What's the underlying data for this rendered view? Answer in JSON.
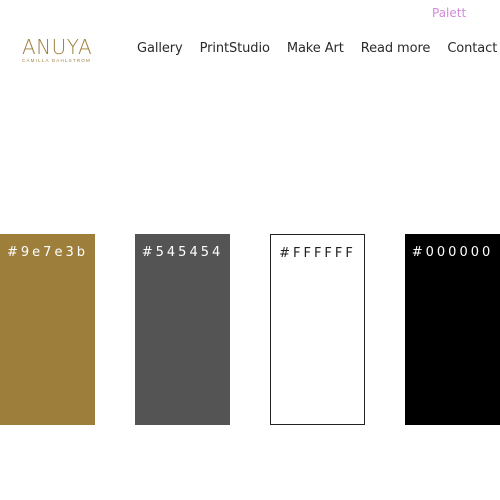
{
  "top_link": {
    "label": "Palett",
    "color": "#d48ad8"
  },
  "logo": {
    "name": "ANUYA",
    "tagline": "CAMILLA DAHLSTROM",
    "color": "#9e7e3b"
  },
  "nav": {
    "items": [
      "Gallery",
      "PrintStudio",
      "Make Art",
      "Read more",
      "Contact"
    ]
  },
  "swatches": [
    {
      "label": "#9e7e3b",
      "color": "#9e7e3b",
      "text_color": "#ffffff",
      "border": "none"
    },
    {
      "label": "#545454",
      "color": "#545454",
      "text_color": "#ffffff",
      "border": "none"
    },
    {
      "label": "#FFFFFF",
      "color": "#ffffff",
      "text_color": "#222222",
      "border": "#222222"
    },
    {
      "label": "#000000",
      "color": "#000000",
      "text_color": "#ffffff",
      "border": "none"
    }
  ]
}
